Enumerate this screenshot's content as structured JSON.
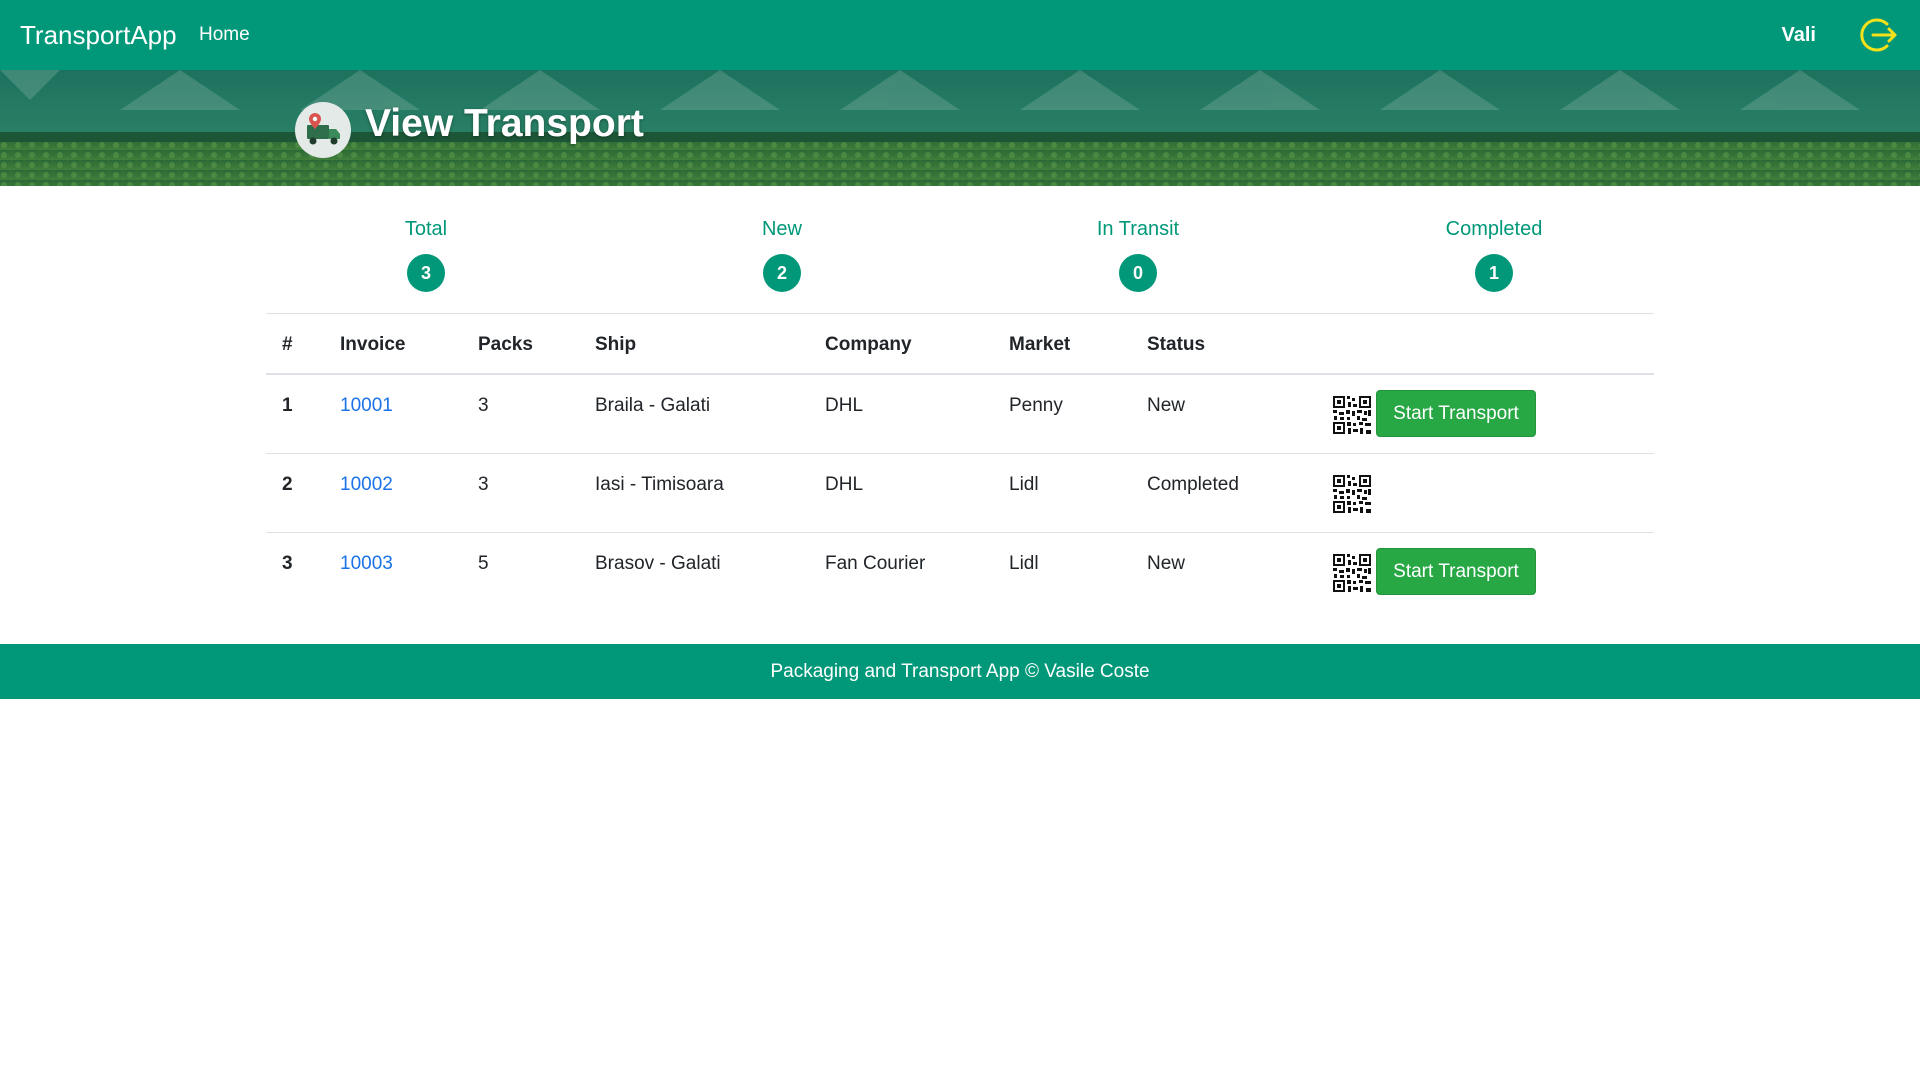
{
  "navbar": {
    "brand": "TransportApp",
    "home_label": "Home",
    "user_name": "Vali",
    "logout_icon": "logout-icon"
  },
  "banner": {
    "title": "View Transport",
    "icon": "delivery-truck-icon"
  },
  "stats": [
    {
      "label": "Total",
      "value": "3"
    },
    {
      "label": "New",
      "value": "2"
    },
    {
      "label": "In Transit",
      "value": "0"
    },
    {
      "label": "Completed",
      "value": "1"
    }
  ],
  "table": {
    "headers": [
      "#",
      "Invoice",
      "Packs",
      "Ship",
      "Company",
      "Market",
      "Status"
    ],
    "rows": [
      {
        "num": "1",
        "invoice": "10001",
        "packs": "3",
        "ship": "Braila - Galati",
        "company": "DHL",
        "market": "Penny",
        "status": "New",
        "action": "Start Transport"
      },
      {
        "num": "2",
        "invoice": "10002",
        "packs": "3",
        "ship": "Iasi - Timisoara",
        "company": "DHL",
        "market": "Lidl",
        "status": "Completed",
        "action": ""
      },
      {
        "num": "3",
        "invoice": "10003",
        "packs": "5",
        "ship": "Brasov - Galati",
        "company": "Fan Courier",
        "market": "Lidl",
        "status": "New",
        "action": "Start Transport"
      }
    ]
  },
  "footer": {
    "text": "Packaging and Transport App © Vasile Coste"
  },
  "colors": {
    "primary": "#009879",
    "button": "#28a745",
    "link": "#1a73e8",
    "logout_icon": "#f5e11a"
  }
}
